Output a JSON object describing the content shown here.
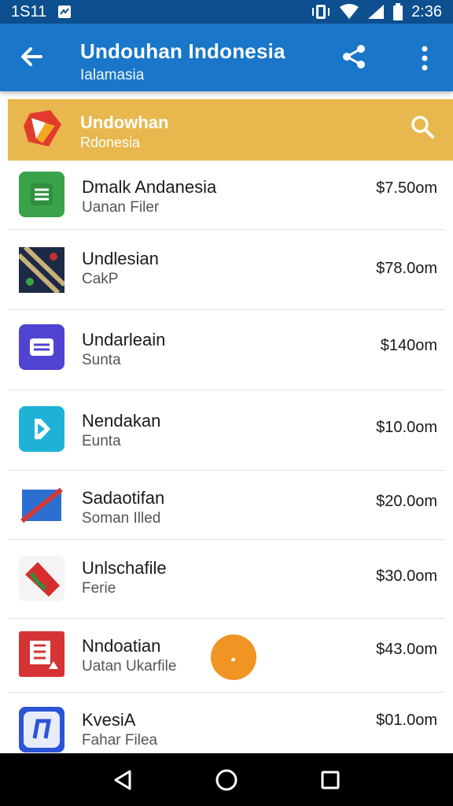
{
  "status": {
    "time_left": "1S11",
    "clock": "2:36"
  },
  "appbar": {
    "title": "Undouhan Indonesia",
    "subtitle": "Ialamasia"
  },
  "app_card": {
    "name": "Undowhan",
    "sub": "Rdonesia"
  },
  "items": [
    {
      "title": "Dmalk Andanesia",
      "subtitle": "Uanan Filer",
      "price": "$7.50om"
    },
    {
      "title": "Undlesian",
      "subtitle": "CakP",
      "price": "$78.0om"
    },
    {
      "title": "Undarleain",
      "subtitle": "Sunta",
      "price": "$140om"
    },
    {
      "title": "Nendakan",
      "subtitle": "Eunta",
      "price": "$10.0om"
    },
    {
      "title": "Sadaotifan",
      "subtitle": "Soman Illed",
      "price": "$20.0om"
    },
    {
      "title": "Unlschafile",
      "subtitle": "Ferie",
      "price": "$30.0om"
    },
    {
      "title": "Nndoatian",
      "subtitle": "Uatan Ukarfile",
      "price": "$43.0om"
    },
    {
      "title": "KvesiA",
      "subtitle": "Fahar Filea",
      "price": "$01.0om"
    }
  ],
  "colors": {
    "statusbar": "#0d4f8f",
    "appbar": "#1976c8",
    "card": "#e8b84e",
    "fab": "#f09423"
  }
}
